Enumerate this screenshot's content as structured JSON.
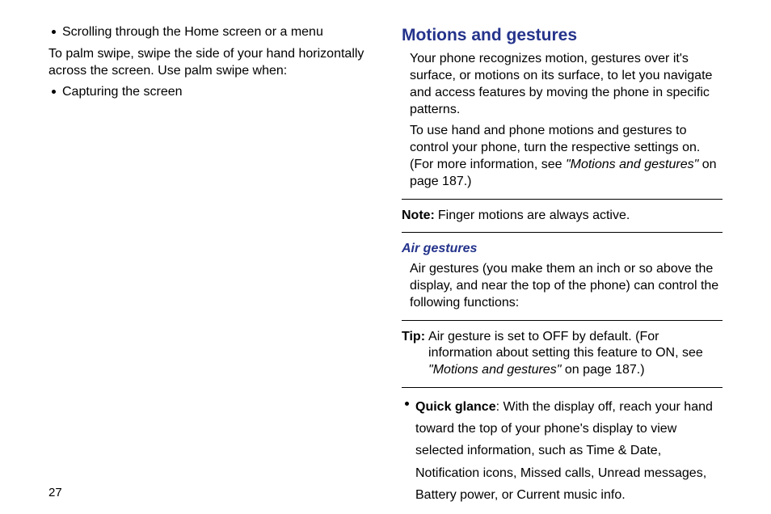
{
  "left": {
    "bullet1": "Scrolling through the Home screen or a menu",
    "para1": "To palm swipe, swipe the side of your hand horizontally across the screen. Use palm swipe when:",
    "bullet2": "Capturing the screen"
  },
  "right": {
    "h1": "Motions and gestures",
    "para1": "Your phone recognizes motion, gestures over it's surface, or motions on its surface, to let you navigate and access features by moving the phone in specific patterns.",
    "para2a": "To use hand and phone motions and gestures to control your phone, turn the respective settings on. (For more information, see ",
    "para2_ref": "\"Motions and gestures\"",
    "para2b": " on page 187.)",
    "note_label": "Note:",
    "note_body": "Finger motions are always active.",
    "h2": "Air gestures",
    "para3": "Air gestures (you make them an inch or so above the display, and near the top of the phone) can control the following functions:",
    "tip_label": "Tip:",
    "tip_a": "Air gesture is set to OFF by default. (For information about setting this feature to ON, see ",
    "tip_ref": "\"Motions and gestures\"",
    "tip_b": " on page 187.)",
    "qg_label": "Quick glance",
    "qg_body": ": With the display off, reach your hand toward the top of your phone's display to view selected information, such as Time & Date, Notification icons, Missed calls, Unread messages, Battery power, or Current music info."
  },
  "page_number": "27"
}
